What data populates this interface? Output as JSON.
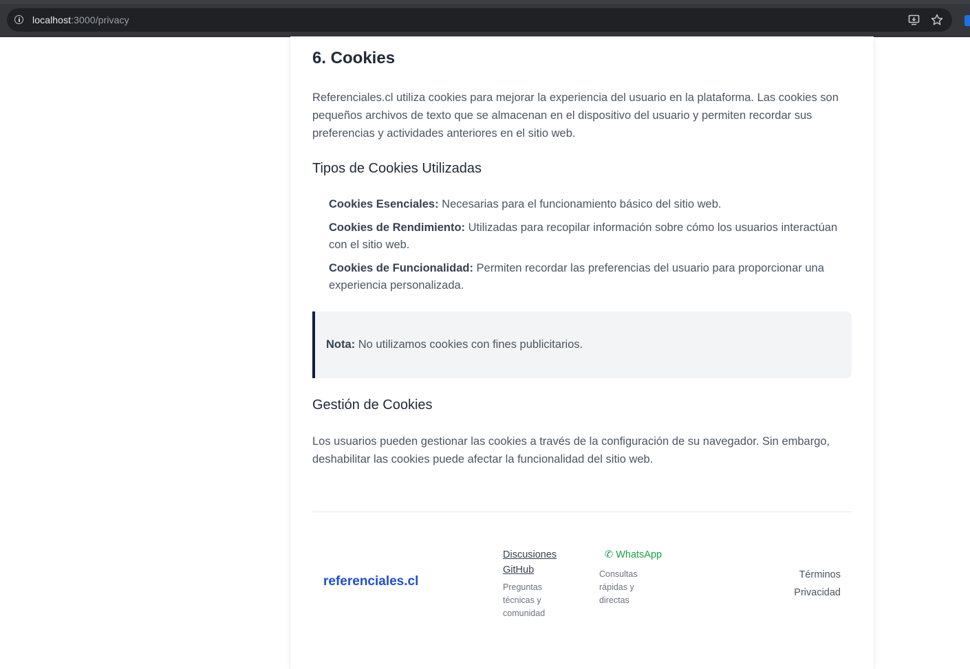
{
  "browser": {
    "url_host": "localhost",
    "url_path": ":3000/privacy"
  },
  "section": {
    "title": "6. Cookies",
    "intro": "Referenciales.cl utiliza cookies para mejorar la experiencia del usuario en la plataforma. Las cookies son pequeños archivos de texto que se almacenan en el dispositivo del usuario y permiten recordar sus preferencias y actividades anteriores en el sitio web.",
    "types_heading": "Tipos de Cookies Utilizadas",
    "types": [
      {
        "name": "Cookies Esenciales:",
        "desc": " Necesarias para el funcionamiento básico del sitio web."
      },
      {
        "name": "Cookies de Rendimiento:",
        "desc": " Utilizadas para recopilar información sobre cómo los usuarios interactúan con el sitio web."
      },
      {
        "name": "Cookies de Funcionalidad:",
        "desc": " Permiten recordar las preferencias del usuario para proporcionar una experiencia personalizada."
      }
    ],
    "note_label": "Nota:",
    "note_text": " No utilizamos cookies con fines publicitarios.",
    "management_heading": "Gestión de Cookies",
    "management_text": "Los usuarios pueden gestionar las cookies a través de la configuración de su navegador. Sin embargo, deshabilitar las cookies puede afectar la funcionalidad del sitio web."
  },
  "footer": {
    "brand": "referenciales.cl",
    "github_link": "Discusiones GitHub",
    "github_desc": "Preguntas técnicas y comunidad",
    "whatsapp_icon_glyph": "✆",
    "whatsapp_link": "WhatsApp",
    "whatsapp_desc": "Consultas rápidas y directas",
    "terms": "Términos",
    "privacy": "Privacidad"
  },
  "colors": {
    "brand": "#1d4ed8",
    "whatsapp": "#16a34a",
    "note_border": "#0f1f3d"
  }
}
